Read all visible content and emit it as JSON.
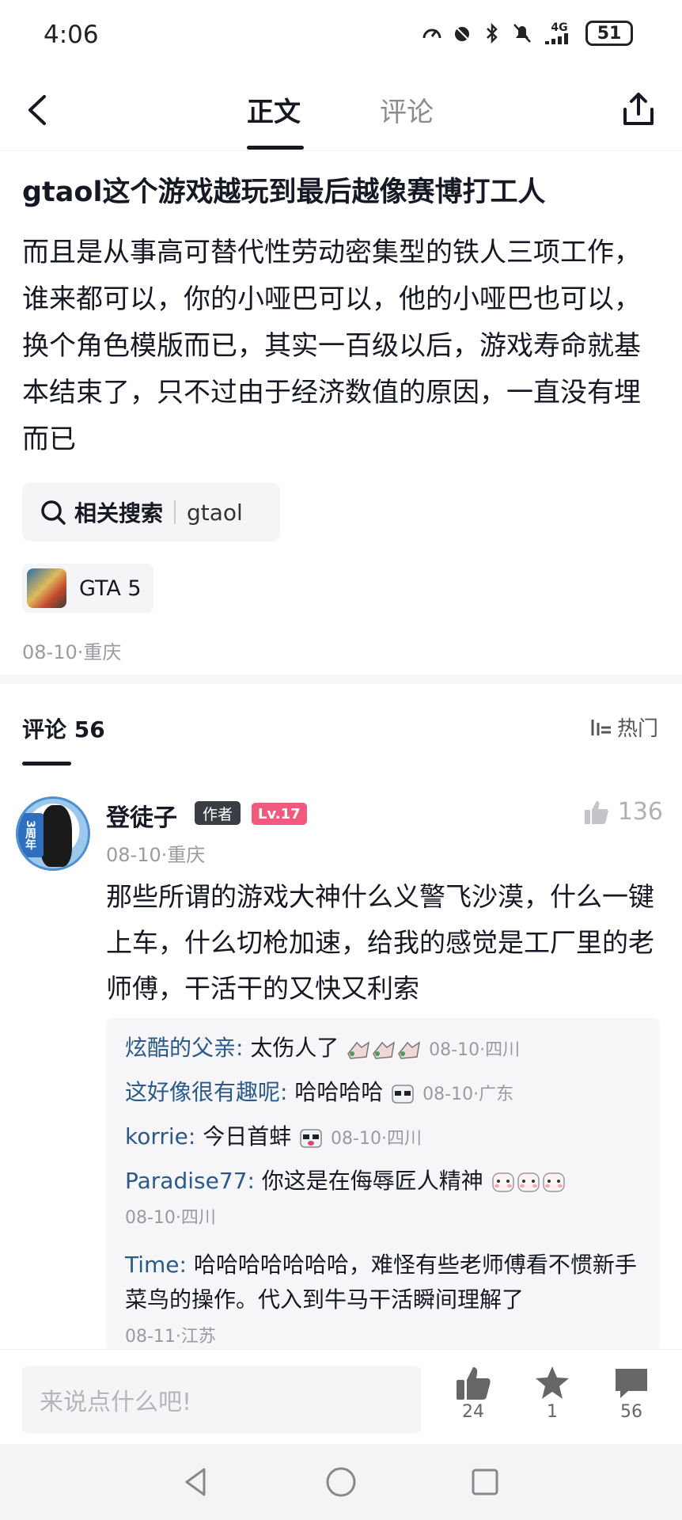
{
  "status_bar": {
    "time": "4:06",
    "network": "4G",
    "battery": "51"
  },
  "nav": {
    "tab_active": "正文",
    "tab_inactive": "评论"
  },
  "post": {
    "title": "gtaol这个游戏越玩到最后越像赛博打工人",
    "body": "而且是从事高可替代性劳动密集型的铁人三项工作，谁来都可以，你的小哑巴可以，他的小哑巴也可以，换个角色模版而已，其实一百级以后，游戏寿命就基本结束了，只不过由于经济数值的原因，一直没有埋而已",
    "search_label": "相关搜索",
    "search_keyword": "gtaol",
    "game_tag": "GTA 5",
    "meta": "08-10·重庆"
  },
  "comments": {
    "title": "评论 56",
    "sort": "热门",
    "top": {
      "name": "登徒子",
      "author_tag": "作者",
      "level": "Lv.17",
      "likes": "136",
      "meta": "08-10·重庆",
      "text": "那些所谓的游戏大神什么义警飞沙漠，什么一键上车，什么切枪加速，给我的感觉是工厂里的老师傅，干活干的又快又利索",
      "avatar_badge": "3周年"
    },
    "replies": [
      {
        "name": "炫酷的父亲:",
        "text": " 太伤人了",
        "meta": "08-10·四川"
      },
      {
        "name": "这好像很有趣呢:",
        "text": " 哈哈哈哈",
        "meta": "08-10·广东"
      },
      {
        "name": "korrie:",
        "text": " 今日首蚌",
        "meta": "08-10·四川"
      },
      {
        "name": "Paradise77:",
        "text": " 你这是在侮辱匠人精神",
        "meta": "08-10·四川"
      },
      {
        "name": "Time:",
        "text": " 哈哈哈哈哈哈哈，难怪有些老师傅看不惯新手菜鸟的操作。代入到牛马干活瞬间理解了",
        "meta": "08-11·江苏"
      }
    ]
  },
  "bottom_bar": {
    "input_placeholder": "来说点什么吧!",
    "like_count": "24",
    "favorite_count": "1",
    "comment_count": "56"
  }
}
